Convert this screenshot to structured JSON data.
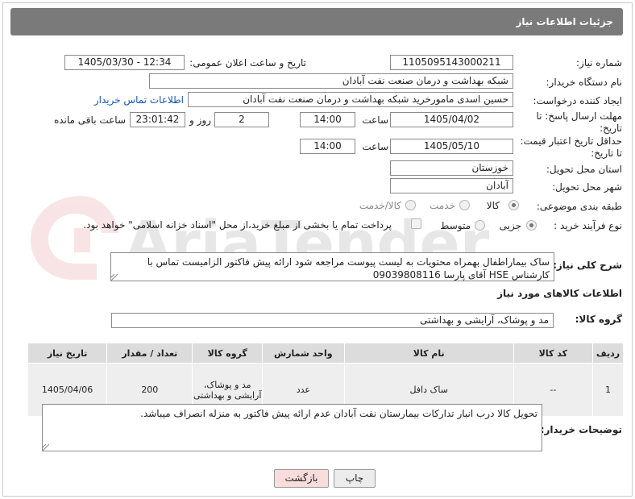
{
  "header": {
    "title": "جزئیات اطلاعات نیاز"
  },
  "watermark": {
    "text": "AriaTender.net"
  },
  "form": {
    "need_number": {
      "label": "شماره نیاز:",
      "value": "1105095143000211"
    },
    "announce_datetime": {
      "label": "تاریخ و ساعت اعلان عمومی:",
      "value": "1405/03/30 - 12:34"
    },
    "buyer_org": {
      "label": "نام دستگاه خریدار:",
      "value": "شبکه بهداشت و درمان صنعت نفت آبادان"
    },
    "requester": {
      "label": "ایجاد کننده درخواست:",
      "value": "حسین اسدی مامورخرید شبکه بهداشت و درمان صنعت نفت آبادان",
      "contact_link": "اطلاعات تماس خریدار"
    },
    "reply_deadline": {
      "label_line1": "مهلت ارسال پاسخ: تا",
      "label_line2": "تاریخ:",
      "date": "1405/04/02",
      "time_label": "ساعت",
      "time": "14:00",
      "days": "2",
      "days_label": "روز و",
      "remaining": "23:01:42",
      "remaining_label": "ساعت باقی مانده"
    },
    "price_validity": {
      "label_line1": "حداقل تاریخ اعتبار قیمت:",
      "label_line2": "تا تاریخ:",
      "date": "1405/05/10",
      "time_label": "ساعت",
      "time": "14:00"
    },
    "province": {
      "label": "استان محل تحویل:",
      "value": "خوزستان"
    },
    "city": {
      "label": "شهر محل تحویل:",
      "value": "آبادان"
    },
    "category": {
      "label": "طبقه بندی موضوعی:",
      "options": [
        "کالا",
        "خدمت",
        "کالا/خدمت"
      ],
      "selected": "کالا"
    },
    "purchase_type": {
      "label": "نوع فرآیند خرید :",
      "options": [
        "جزیی",
        "متوسط"
      ],
      "selected": "جزیی",
      "payment_note": "پرداخت تمام یا بخشی از مبلغ خرید،از محل \"اسناد خزانه اسلامی\" خواهد بود."
    },
    "general_description": {
      "label": "شرح کلی نیاز:",
      "value": "ساک بیماراطفال بهمراه محتویات به لیست پیوست مراجعه شود ارائه پیش فاکتور الزامیست تماس با کارشناس HSE آقای پارسا 09039808116"
    }
  },
  "goods": {
    "section_title": "اطلاعات کالاهای مورد نیاز",
    "group_label": "گروه کالا:",
    "group_value": "مد و پوشاک، آرایشی و بهداشتی",
    "columns": [
      "ردیف",
      "کد کالا",
      "نام کالا",
      "واحد شمارش",
      "گروه کالا",
      "تعداد / مقدار",
      "تاریخ نیاز"
    ],
    "rows": [
      {
        "row": "1",
        "code": "--",
        "name": "ساک دافل",
        "unit": "عدد",
        "group": "مد و پوشاک، آرایشی و بهداشتی",
        "qty": "200",
        "date": "1405/04/06"
      }
    ]
  },
  "buyer_notes": {
    "label": "توضیحات خریدار:",
    "value": "تحویل کالا درب انبار تدارکات بیمارستان نفت آبادان عدم ارائه پیش فاکتور به منزله انصراف میباشد."
  },
  "buttons": {
    "print": "چاپ",
    "back": "بازگشت"
  },
  "colors": {
    "header_bg": "#7a7a7a",
    "link": "#1b56b8",
    "back_button_bg": "#f9dcdc",
    "print_button_bg": "#ececec"
  }
}
